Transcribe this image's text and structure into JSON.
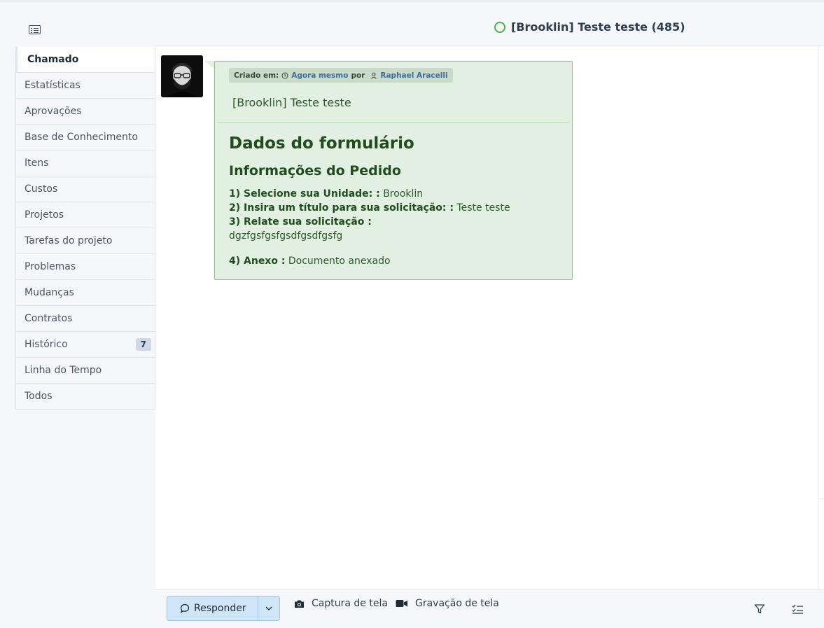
{
  "header": {
    "title": "[Brooklin] Teste teste (485)",
    "status_color": "#4caf50"
  },
  "sidebar": {
    "items": [
      {
        "label": "Chamado"
      },
      {
        "label": "Estatísticas"
      },
      {
        "label": "Aprovações"
      },
      {
        "label": "Base de Conhecimento"
      },
      {
        "label": "Itens"
      },
      {
        "label": "Custos"
      },
      {
        "label": "Projetos"
      },
      {
        "label": "Tarefas do projeto"
      },
      {
        "label": "Problemas"
      },
      {
        "label": "Mudanças"
      },
      {
        "label": "Contratos"
      },
      {
        "label": "Histórico",
        "count": "7"
      },
      {
        "label": "Linha do Tempo"
      },
      {
        "label": "Todos"
      }
    ]
  },
  "ticket": {
    "created_label": "Criado em:",
    "created_value": "Agora mesmo",
    "by_label": "por",
    "author": "Raphael Aracelli",
    "title": "[Brooklin] Teste teste",
    "form_heading": "Dados do formulário",
    "section_heading": "Informações do Pedido",
    "fields": [
      {
        "label": "1) Selecione sua Unidade: :",
        "value": "Brooklin"
      },
      {
        "label": "2) Insira um título para sua solicitação: :",
        "value": "Teste teste"
      },
      {
        "label": "3) Relate sua solicitação :",
        "value": "dgzfgsfgsfgsdfgsdfgsfg"
      },
      {
        "label": "4) Anexo :",
        "value": "Documento anexado"
      }
    ]
  },
  "footer": {
    "reply_label": "Responder",
    "screenshot_label": "Captura de tela",
    "recording_label": "Gravação de tela"
  }
}
